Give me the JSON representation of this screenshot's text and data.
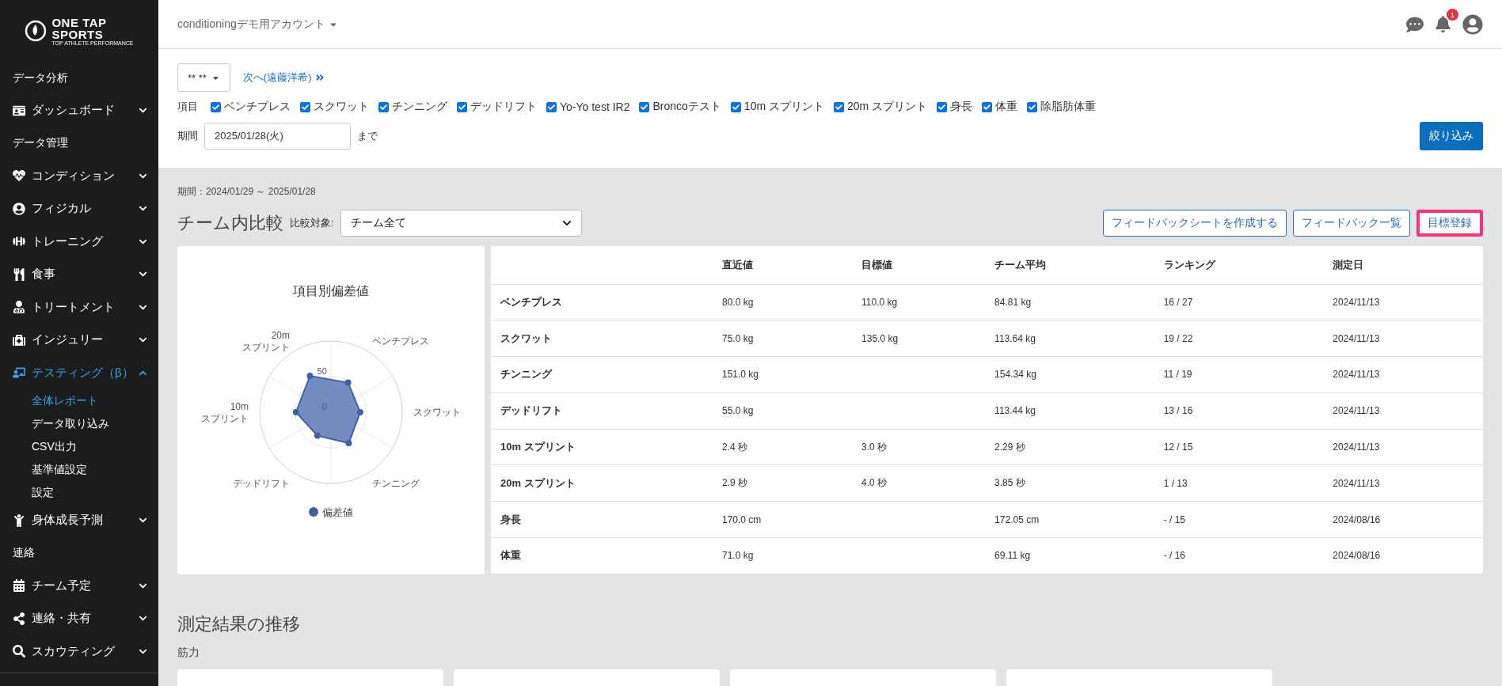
{
  "logo": {
    "line_1": "ONE TAP",
    "line_2": "SPORTS",
    "tagline": "TOP ATHLETE PERFORMANCE"
  },
  "sidebar": {
    "items": [
      {
        "kind": "heading",
        "label": "データ分析"
      },
      {
        "kind": "menu",
        "label": "ダッシュボード",
        "expanded": false
      },
      {
        "kind": "heading",
        "label": "データ管理"
      },
      {
        "kind": "menu",
        "label": "コンディション",
        "expanded": false
      },
      {
        "kind": "menu",
        "label": "フィジカル",
        "expanded": false
      },
      {
        "kind": "menu",
        "label": "トレーニング",
        "expanded": false
      },
      {
        "kind": "menu",
        "label": "食事",
        "expanded": false
      },
      {
        "kind": "menu",
        "label": "トリートメント",
        "expanded": false
      },
      {
        "kind": "menu",
        "label": "インジュリー",
        "expanded": false
      },
      {
        "kind": "menu",
        "label": "テスティング（β）",
        "expanded": true,
        "children": [
          {
            "label": "全体レポート",
            "selected": true
          },
          {
            "label": "データ取り込み",
            "selected": false
          },
          {
            "label": "CSV出力",
            "selected": false
          },
          {
            "label": "基準値設定",
            "selected": false
          },
          {
            "label": "設定",
            "selected": false
          }
        ]
      },
      {
        "kind": "menu",
        "label": "身体成長予測",
        "expanded": false
      },
      {
        "kind": "heading",
        "label": "連絡"
      },
      {
        "kind": "menu",
        "label": "チーム予定",
        "expanded": false
      },
      {
        "kind": "menu",
        "label": "連絡・共有",
        "expanded": false
      },
      {
        "kind": "menu",
        "label": "スカウティング",
        "expanded": false
      }
    ]
  },
  "header": {
    "account": "conditioningデモ用アカウント",
    "notification_count": "1"
  },
  "filter": {
    "athlete_select": "** **",
    "next_link": "次へ(遠藤洋希)",
    "items_label": "項目",
    "items": [
      {
        "label": "ベンチプレス",
        "checked": true
      },
      {
        "label": "スクワット",
        "checked": true
      },
      {
        "label": "チンニング",
        "checked": true
      },
      {
        "label": "デッドリフト",
        "checked": true
      },
      {
        "label": "Yo-Yo test IR2",
        "checked": true
      },
      {
        "label": "Broncoテスト",
        "checked": true
      },
      {
        "label": "10m スプリント",
        "checked": true
      },
      {
        "label": "20m スプリント",
        "checked": true
      },
      {
        "label": "身長",
        "checked": true
      },
      {
        "label": "体重",
        "checked": true
      },
      {
        "label": "除脂肪体重",
        "checked": true
      }
    ],
    "period_label": "期間",
    "period_value": "2025/01/28(火)",
    "period_suffix": "まで",
    "submit": "絞り込み"
  },
  "period_text": "期間：2024/01/29 ～ 2025/01/28",
  "comparison": {
    "title": "チーム内比較",
    "target_label": "比較対象:",
    "target_value": "チーム全て",
    "buttons": [
      {
        "label": "フィードバックシートを作成する",
        "highlighted": false
      },
      {
        "label": "フィードバック一覧",
        "highlighted": false
      },
      {
        "label": "目標登録",
        "highlighted": true
      }
    ]
  },
  "radar": {
    "title": "項目別偏差値",
    "axis_labels": [
      "ベンチプレス",
      "スクワット",
      "チンニング",
      "デッドリフト",
      "10m スプリント",
      "20m スプリント"
    ],
    "tick_labels": [
      "50",
      "0"
    ],
    "legend": "偏差値"
  },
  "table": {
    "columns": [
      "直近値",
      "目標値",
      "チーム平均",
      "ランキング",
      "測定日"
    ],
    "rows": [
      {
        "name": "ベンチプレス",
        "latest": "80.0 kg",
        "goal": "110.0 kg",
        "average": "84.81 kg",
        "ranking": "16 / 27",
        "date": "2024/11/13"
      },
      {
        "name": "スクワット",
        "latest": "75.0 kg",
        "goal": "135.0 kg",
        "average": "113.64 kg",
        "ranking": "19 / 22",
        "date": "2024/11/13"
      },
      {
        "name": "チンニング",
        "latest": "151.0 kg",
        "average": "154.34 kg",
        "ranking": "11 / 19",
        "date": "2024/11/13"
      },
      {
        "name": "デッドリフト",
        "latest": "55.0 kg",
        "average": "113.44 kg",
        "ranking": "13 / 16",
        "date": "2024/11/13"
      },
      {
        "name": "10m スプリント",
        "latest": "2.4 秒",
        "goal": "3.0 秒",
        "average": "2.29 秒",
        "ranking": "12 / 15",
        "date": "2024/11/13"
      },
      {
        "name": "20m スプリント",
        "latest": "2.9 秒",
        "goal": "4.0 秒",
        "average": "3.85 秒",
        "ranking": "1 / 13",
        "date": "2024/11/13"
      },
      {
        "name": "身長",
        "latest": "170.0 cm",
        "average": "172.05 cm",
        "ranking": "- / 15",
        "date": "2024/08/16"
      },
      {
        "name": "体重",
        "latest": "71.0 kg",
        "average": "69.11 kg",
        "ranking": "- / 16",
        "date": "2024/08/16"
      }
    ]
  },
  "trend": {
    "title": "測定結果の推移",
    "section": "筋力"
  }
}
